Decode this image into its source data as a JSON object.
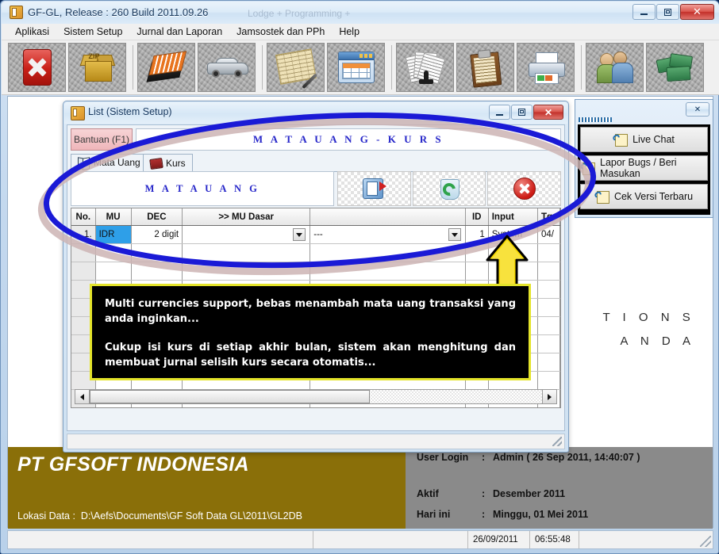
{
  "window": {
    "title": "GF-GL, Release : 260 Build 2011.09.26",
    "ghost_title": "Lodge + Programming +",
    "minimize_label": "Minimize",
    "maximize_label": "Maximize",
    "close_label": "✕"
  },
  "menu": {
    "items": [
      "Aplikasi",
      "Sistem Setup",
      "Jurnal dan Laporan",
      "Jamsostek dan PPh",
      "Help"
    ]
  },
  "toolbar": {
    "buttons": [
      {
        "name": "exit-button",
        "icon": "red-x-icon"
      },
      {
        "name": "backup-zip-button",
        "icon": "zip-box-icon"
      },
      {
        "name": "master-data-button",
        "icon": "orange-book-icon"
      },
      {
        "name": "asset-vehicle-button",
        "icon": "car-icon"
      },
      {
        "name": "journal-entry-button",
        "icon": "ledger-pen-icon"
      },
      {
        "name": "grid-window-button",
        "icon": "window-grid-icon"
      },
      {
        "name": "reports-button",
        "icon": "papers-stamp-icon"
      },
      {
        "name": "clipboard-button",
        "icon": "clipboard-icon"
      },
      {
        "name": "print-button",
        "icon": "printer-icon"
      },
      {
        "name": "users-button",
        "icon": "two-users-icon"
      },
      {
        "name": "cash-button",
        "icon": "money-stack-icon"
      }
    ]
  },
  "desktop": {
    "watermark_line1": "T I O N S",
    "watermark_line2": "A N D A"
  },
  "child_window": {
    "title": "List (Sistem Setup)",
    "help_button": "Bantuan (F1)",
    "header_title": "M A T A   U A N G   -   K U R S",
    "minimize_label": "Minimize",
    "maximize_label": "Maximize",
    "close_label": "✕",
    "tabs": [
      {
        "label": "Mata Uang",
        "icon": "open-book-icon",
        "active": true
      },
      {
        "label": "Kurs",
        "icon": "red-book-icon",
        "active": false
      }
    ],
    "panel_title": "M A T A   U A N G",
    "actions": [
      {
        "name": "export-button",
        "icon": "export-arrow-icon"
      },
      {
        "name": "refresh-button",
        "icon": "refresh-recycle-icon"
      },
      {
        "name": "close-record-button",
        "icon": "red-circle-x-icon"
      }
    ],
    "grid": {
      "columns": [
        "No.",
        "MU",
        "DEC",
        ">> MU Dasar",
        "",
        "ID",
        "Input",
        "Tg"
      ],
      "rows": [
        {
          "no": "1.",
          "mu": "IDR",
          "dec": "2 digit",
          "mu_dasar": "",
          "extra": "---",
          "id": "1",
          "input": "System",
          "tgl": "04/"
        }
      ],
      "empty_row_count": 9
    },
    "scrollbar": {
      "left_arrow": "◀",
      "right_arrow": "▶",
      "thumb_percent": 62
    }
  },
  "side_panel": {
    "close_label": "✕",
    "buttons": [
      {
        "label": "Live Chat",
        "icon": "chat-note-icon"
      },
      {
        "label": "Lapor Bugs / Beri Masukan",
        "icon": "chat-note-icon"
      },
      {
        "label": "Cek Versi Terbaru",
        "icon": "chat-note-icon"
      }
    ]
  },
  "annotation": {
    "callout_paragraph_1": "Multi currencies support, bebas menambah mata uang transaksi yang anda inginkan...",
    "callout_paragraph_2": "Cukup isi kurs di setiap akhir bulan, sistem akan menghitung dan membuat jurnal selisih kurs secara otomatis...",
    "ellipse_color": "#1a1ad6",
    "arrow_color": "#f0d000",
    "callout_border_color": "#e3e32a"
  },
  "brand": {
    "company": "PT GFSOFT INDONESIA",
    "data_location_label": "Lokasi Data :",
    "data_location_value": "D:\\Aefs\\Documents\\GF Soft Data GL\\2011\\GL2DB",
    "info": [
      {
        "key": "User Login",
        "sep": ":",
        "value": "Admin ( 26 Sep 2011, 14:40:07 )"
      },
      {
        "key": "Aktif",
        "sep": ":",
        "value": "Desember 2011"
      },
      {
        "key": "Hari ini",
        "sep": ":",
        "value": "Minggu, 01 Mei 2011"
      }
    ]
  },
  "statusbar": {
    "cell1": "",
    "cell2": "",
    "date": "26/09/2011",
    "time": "06:55:48",
    "cell5": ""
  }
}
